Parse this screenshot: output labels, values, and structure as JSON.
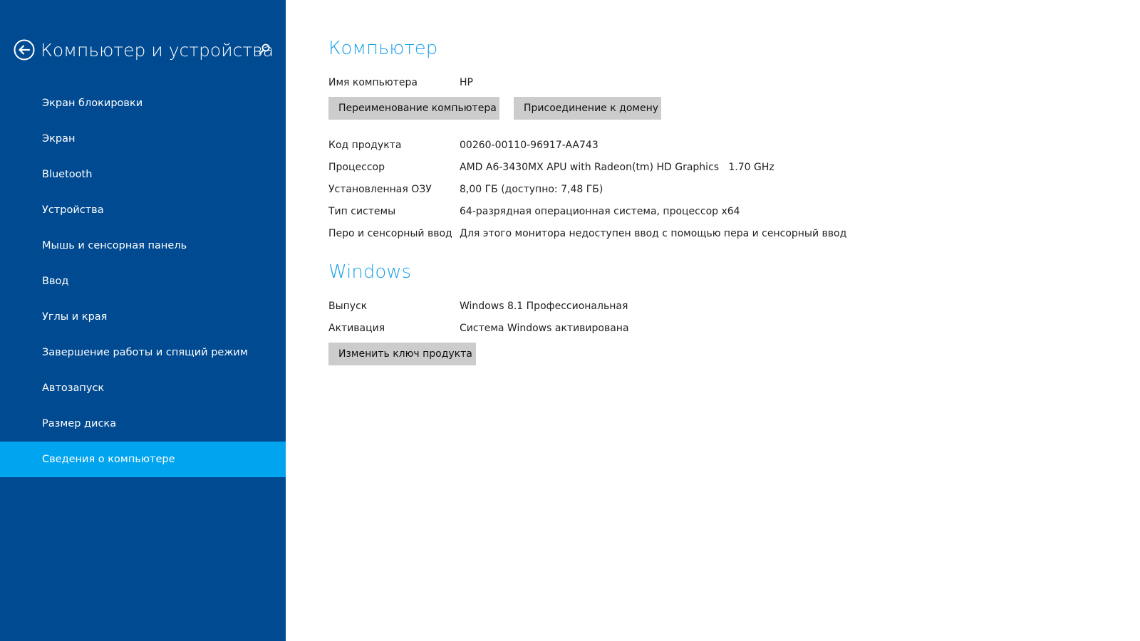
{
  "sidebar": {
    "title": "Компьютер и устройства",
    "items": [
      {
        "label": "Экран блокировки"
      },
      {
        "label": "Экран"
      },
      {
        "label": "Bluetooth"
      },
      {
        "label": "Устройства"
      },
      {
        "label": "Мышь и сенсорная панель"
      },
      {
        "label": "Ввод"
      },
      {
        "label": "Углы и края"
      },
      {
        "label": "Завершение работы и спящий режим"
      },
      {
        "label": "Автозапуск"
      },
      {
        "label": "Размер диска"
      },
      {
        "label": "Сведения о компьютере"
      }
    ],
    "active_item": "Сведения о компьютере"
  },
  "computer": {
    "title": "Компьютер",
    "name_label": "Имя компьютера",
    "name_value": "HP",
    "rename_button": "Переименование компьютера",
    "join_domain_button": "Присоединение к домену",
    "product_id_label": "Код продукта",
    "product_id_value": "00260-00110-96917-AA743",
    "processor_label": "Процессор",
    "processor_value": "AMD A6-3430MX APU with Radeon(tm) HD Graphics   1.70 GHz",
    "ram_label": "Установленная ОЗУ",
    "ram_value": "8,00 ГБ (доступно: 7,48 ГБ)",
    "system_type_label": "Тип системы",
    "system_type_value": "64-разрядная операционная система, процессор x64",
    "pen_touch_label": "Перо и сенсорный ввод",
    "pen_touch_value": "Для этого монитора недоступен ввод с помощью пера и сенсорный ввод"
  },
  "windows": {
    "title": "Windows",
    "edition_label": "Выпуск",
    "edition_value": "Windows 8.1 Профессиональная",
    "activation_label": "Активация",
    "activation_value": "Система Windows активирована",
    "change_key_button": "Изменить ключ продукта"
  },
  "icons": {
    "back": "back-arrow-icon",
    "search": "search-icon"
  },
  "colors": {
    "sidebar_bg": "#004a91",
    "sidebar_active": "#00a4ef",
    "heading": "#1da1e7",
    "button_bg": "#cccccc"
  }
}
